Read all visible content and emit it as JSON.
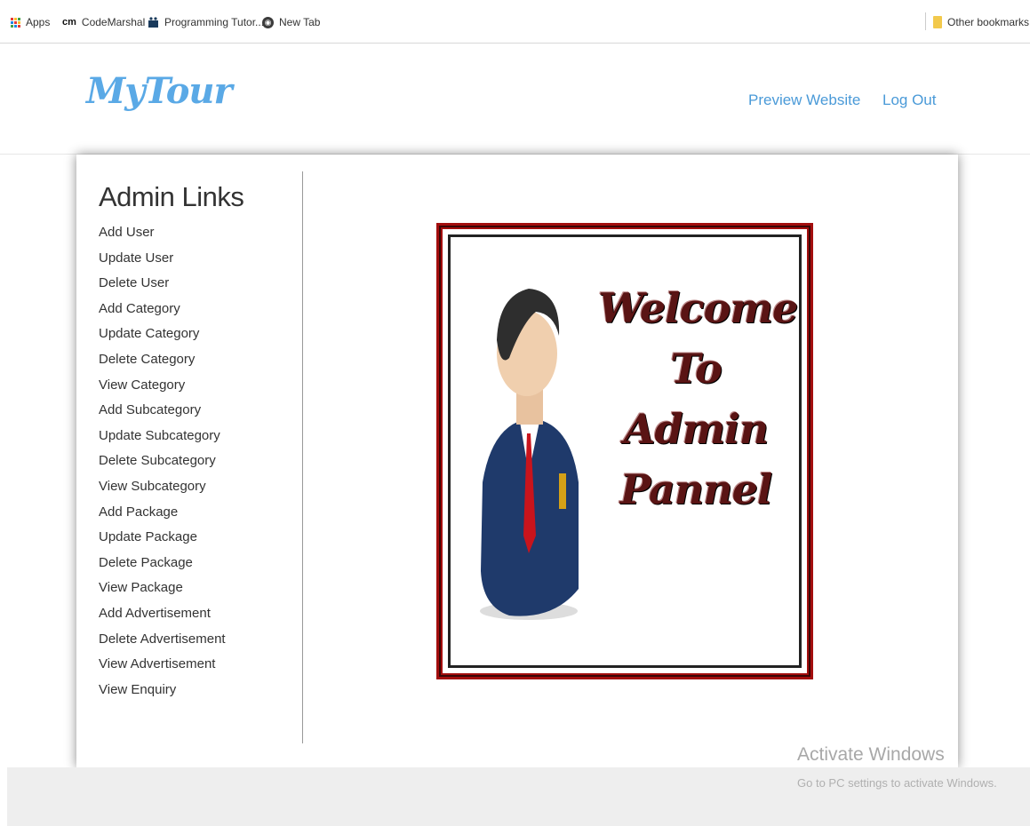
{
  "bookmarks": {
    "items": [
      {
        "label": "Apps",
        "icon": "apps-grid-icon"
      },
      {
        "label": "CodeMarshal",
        "icon": "cm-icon",
        "icon_text": "cm"
      },
      {
        "label": "Programming Tutor...",
        "icon": "programming-tutorial-icon"
      },
      {
        "label": "New Tab",
        "icon": "globe-icon"
      }
    ],
    "other": {
      "label": "Other bookmarks",
      "icon": "folder-icon"
    }
  },
  "header": {
    "logo": "MyTour",
    "nav": [
      "Preview Website",
      "Log Out"
    ],
    "colors": {
      "logo": "#5aa9e6",
      "link": "#4a9ad8"
    }
  },
  "sidebar": {
    "title": "Admin Links",
    "links": [
      "Add User",
      "Update User",
      "Delete User",
      "Add Category",
      "Update Category",
      "Delete Category",
      "View Category",
      "Add Subcategory",
      "Update Subcategory",
      "Delete Subcategory",
      "View Subcategory",
      "Add Package",
      "Update Package",
      "Delete Package",
      "View Package",
      "Add Advertisement",
      "Delete Advertisement",
      "View Advertisement",
      "View Enquiry"
    ]
  },
  "welcome": {
    "lines": [
      "Welcome",
      "To",
      "Admin",
      "Pannel"
    ],
    "frame_color": "#a30e0e"
  },
  "watermark": {
    "title": "Activate Windows",
    "subtitle": "Go to PC settings to activate Windows."
  }
}
